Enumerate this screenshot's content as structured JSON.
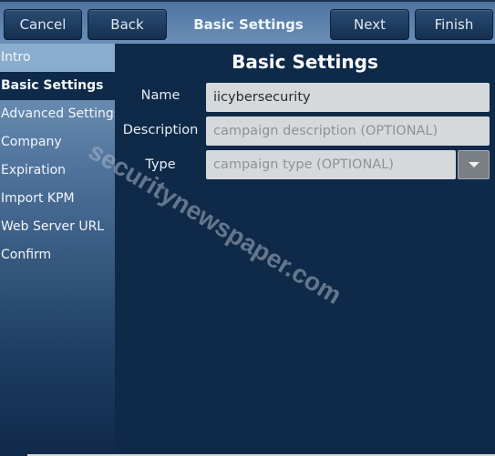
{
  "toolbar": {
    "cancel": "Cancel",
    "back": "Back",
    "title": "Basic Settings",
    "next": "Next",
    "finish": "Finish"
  },
  "sidebar": {
    "items": [
      {
        "label": "Intro"
      },
      {
        "label": "Basic Settings"
      },
      {
        "label": "Advanced Settings"
      },
      {
        "label": "Company"
      },
      {
        "label": "Expiration"
      },
      {
        "label": "Import KPM"
      },
      {
        "label": "Web Server URL"
      },
      {
        "label": "Confirm"
      }
    ],
    "active": "Basic Settings"
  },
  "main": {
    "title": "Basic Settings",
    "name": {
      "label": "Name",
      "value": "iicybersecurity"
    },
    "description": {
      "label": "Description",
      "value": "",
      "placeholder": "campaign description (OPTIONAL)"
    },
    "type": {
      "label": "Type",
      "value": "",
      "placeholder": "campaign type (OPTIONAL)",
      "dropdown_icon": "caret-down-icon"
    }
  },
  "watermark": "securitynewspaper.com",
  "colors": {
    "panel": "#0f2a48",
    "toolbar": "#5a7fa8",
    "button": "#1c3a5c"
  }
}
